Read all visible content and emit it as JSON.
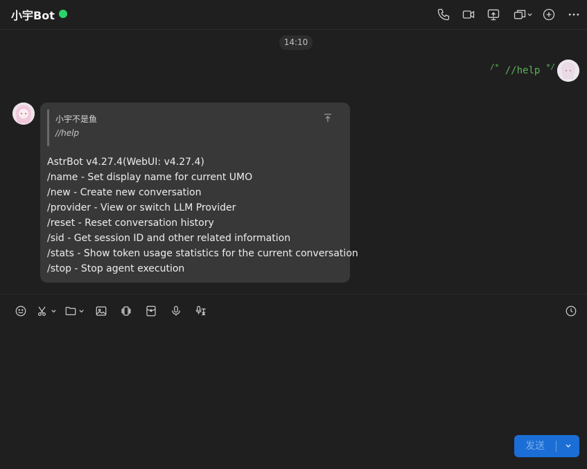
{
  "header": {
    "title": "小宇Bot",
    "status": "online",
    "icons": [
      "phone-icon",
      "video-camera-icon",
      "screen-share-icon",
      "window-switch-icon",
      "add-icon",
      "more-icon"
    ]
  },
  "messages": {
    "time_label": "14:10",
    "sent": {
      "comment_open": "/*",
      "text": "//help",
      "comment_close": "*/"
    },
    "received": {
      "quote": {
        "name": "小宇不是鱼",
        "text": "//help"
      },
      "lines": [
        "AstrBot v4.27.4(WebUI: v4.27.4)",
        "/name - Set display name for current UMO",
        "/new - Create new conversation",
        "/provider - View or switch LLM Provider",
        "/reset - Reset conversation history",
        "/sid - Get session ID and other related information",
        "/stats - Show token usage statistics for the current conversation",
        "/stop - Stop agent execution"
      ]
    }
  },
  "composer": {
    "tools": [
      "emoji-icon",
      "scissors-icon",
      "folder-icon",
      "image-icon",
      "shake-icon",
      "red-packet-icon",
      "microphone-icon",
      "voice-to-text-icon",
      "history-icon"
    ],
    "send_label": "发送"
  },
  "colors": {
    "background": "#1f1f1f",
    "bubble": "#383838",
    "accent": "#1a6ed6",
    "online": "#2bd46b",
    "code_green": "#5fb25b"
  }
}
